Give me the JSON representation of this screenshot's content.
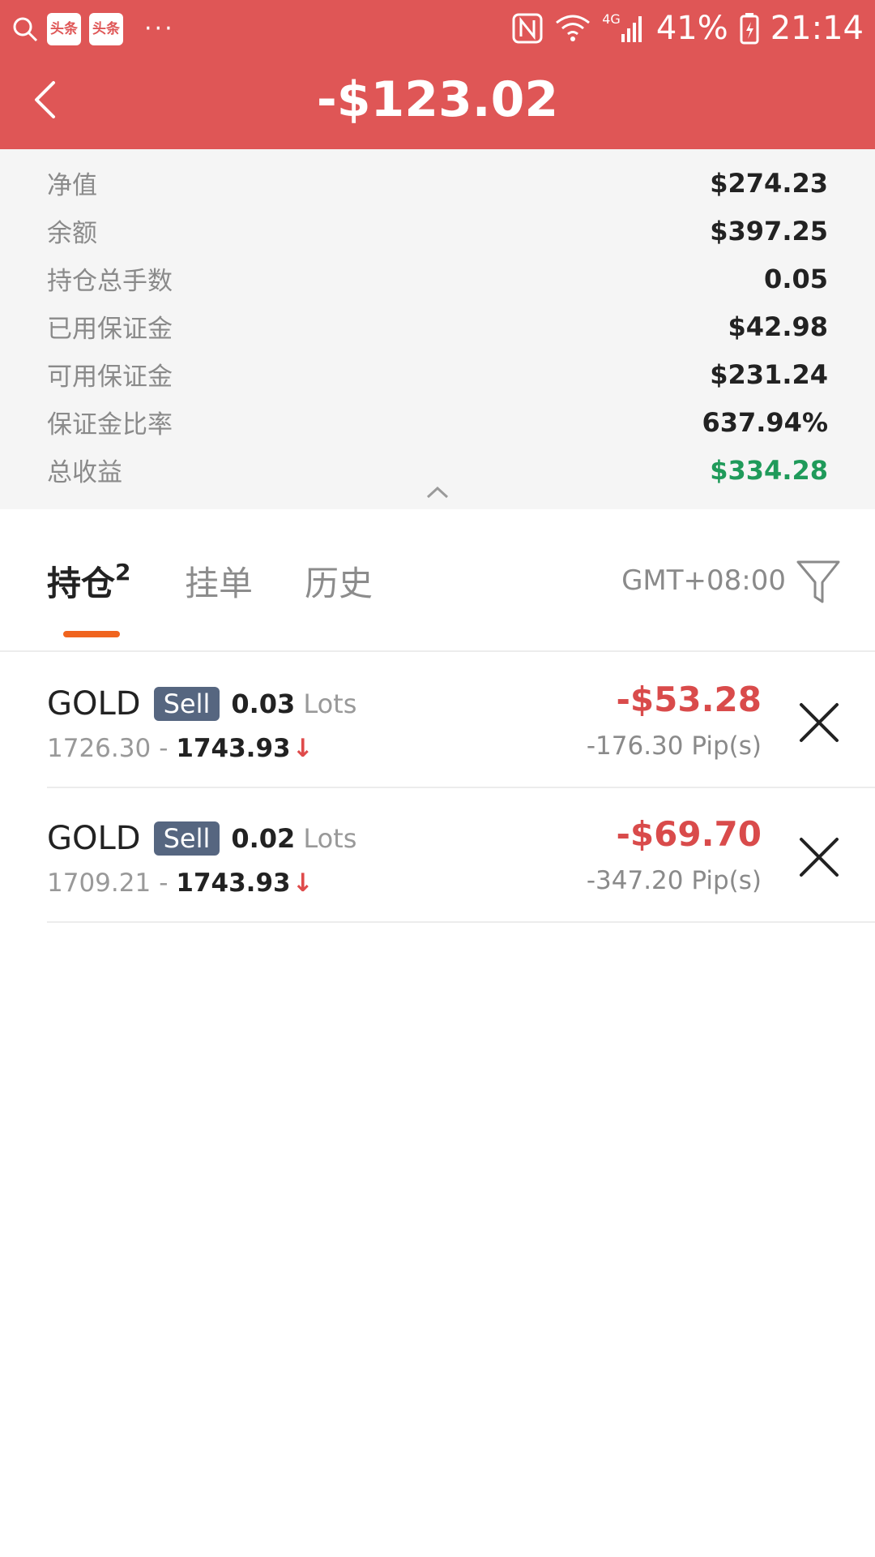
{
  "status_bar": {
    "app_badge_1": "头条",
    "app_badge_2": "头条",
    "dots": "···",
    "battery": "41%",
    "time": "21:14",
    "network": "4G"
  },
  "header": {
    "title": "-$123.02",
    "bg_color": "#df5656"
  },
  "summary": [
    {
      "label": "净值",
      "value": "$274.23"
    },
    {
      "label": "余额",
      "value": "$397.25"
    },
    {
      "label": "持仓总手数",
      "value": "0.05"
    },
    {
      "label": "已用保证金",
      "value": "$42.98"
    },
    {
      "label": "可用保证金",
      "value": "$231.24"
    },
    {
      "label": "保证金比率",
      "value": "637.94%"
    },
    {
      "label": "总收益",
      "value": "$334.28"
    }
  ],
  "tabs": [
    {
      "label": "持仓",
      "badge": "2"
    },
    {
      "label": "挂单"
    },
    {
      "label": "历史"
    }
  ],
  "timezone": "GMT+08:00",
  "positions": [
    {
      "symbol": "GOLD",
      "side": "Sell",
      "lots": "0.03",
      "lots_unit": "Lots",
      "open_price": "1726.30",
      "separator": "-",
      "current_price": "1743.93",
      "arrow": "↓",
      "pnl": "-$53.28",
      "pips": "-176.30 Pip(s)"
    },
    {
      "symbol": "GOLD",
      "side": "Sell",
      "lots": "0.02",
      "lots_unit": "Lots",
      "open_price": "1709.21",
      "separator": "-",
      "current_price": "1743.93",
      "arrow": "↓",
      "pnl": "-$69.70",
      "pips": "-347.20 Pip(s)"
    }
  ],
  "colors": {
    "accent": "#df5656",
    "tab_indicator": "#f0641e",
    "profit": "#1f9a5a",
    "loss": "#d94b4b",
    "badge": "#566680"
  },
  "icons": {
    "back": "back-icon",
    "collapse": "chevron-up-icon",
    "filter": "filter-icon",
    "close": "close-icon"
  }
}
